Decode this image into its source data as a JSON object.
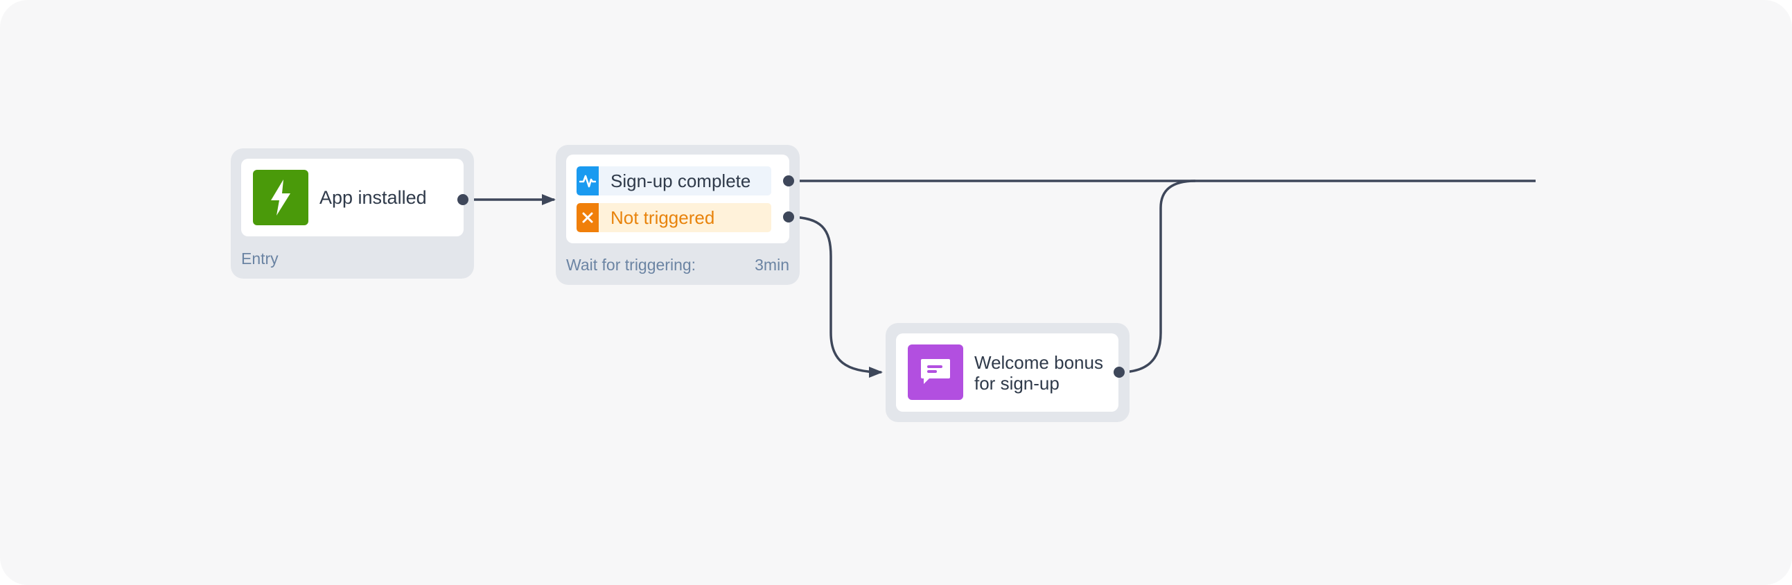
{
  "colors": {
    "canvas": "#f7f7f8",
    "node": "#e3e6eb",
    "wire": "#3e475a",
    "entry_icon": "#4a9a0a",
    "positive_icon": "#1a9af0",
    "positive_bg": "#eef4fb",
    "negative_icon": "#f07f0a",
    "negative_bg": "#fff2da",
    "negative_text": "#e8830c",
    "message_icon": "#b24fe0"
  },
  "entry": {
    "title": "App installed",
    "caption": "Entry",
    "icon": "lightning-icon"
  },
  "wait": {
    "positive": {
      "label": "Sign-up complete",
      "icon": "pulse-icon"
    },
    "negative": {
      "label": "Not triggered",
      "icon": "close-icon"
    },
    "caption": "Wait for triggering:",
    "duration": "3min"
  },
  "message": {
    "title_line1": "Welcome bonus",
    "title_line2": "for sign-up",
    "icon": "message-icon"
  }
}
